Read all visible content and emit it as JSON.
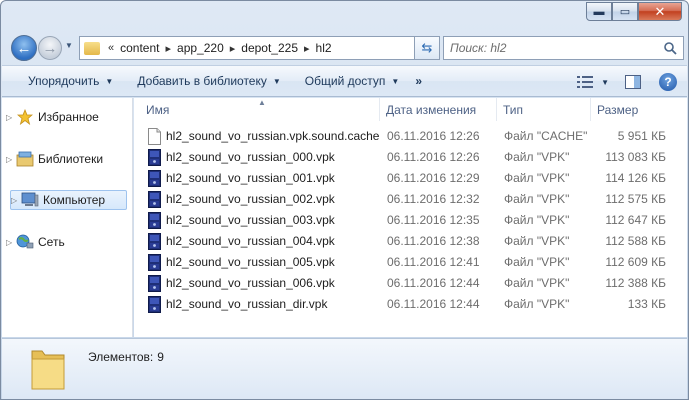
{
  "window": {
    "caption": {
      "minimize": "▬",
      "maximize": "▭",
      "close": "✕"
    }
  },
  "address_bar": {
    "prefix": "«",
    "crumbs": [
      "content",
      "app_220",
      "depot_225",
      "hl2"
    ],
    "separator": "▸"
  },
  "search": {
    "placeholder": "Поиск: hl2"
  },
  "toolbar": {
    "organize": "Упорядочить",
    "add_to_library": "Добавить в библиотеку",
    "share": "Общий доступ",
    "more": "»"
  },
  "nav_pane": {
    "items": [
      {
        "label": "Избранное",
        "icon": "star-icon"
      },
      {
        "label": "Библиотеки",
        "icon": "library-icon"
      },
      {
        "label": "Компьютер",
        "icon": "computer-icon",
        "selected": true
      },
      {
        "label": "Сеть",
        "icon": "network-icon"
      }
    ]
  },
  "file_list": {
    "columns": [
      "Имя",
      "Дата изменения",
      "Тип",
      "Размер"
    ],
    "rows": [
      {
        "name": "hl2_sound_vo_russian.vpk.sound.cache",
        "date": "06.11.2016 12:26",
        "type": "Файл \"CACHE\"",
        "size": "5 951 КБ",
        "icon": "cache-file-icon"
      },
      {
        "name": "hl2_sound_vo_russian_000.vpk",
        "date": "06.11.2016 12:26",
        "type": "Файл \"VPK\"",
        "size": "113 083 КБ",
        "icon": "vpk-file-icon"
      },
      {
        "name": "hl2_sound_vo_russian_001.vpk",
        "date": "06.11.2016 12:29",
        "type": "Файл \"VPK\"",
        "size": "114 126 КБ",
        "icon": "vpk-file-icon"
      },
      {
        "name": "hl2_sound_vo_russian_002.vpk",
        "date": "06.11.2016 12:32",
        "type": "Файл \"VPK\"",
        "size": "112 575 КБ",
        "icon": "vpk-file-icon"
      },
      {
        "name": "hl2_sound_vo_russian_003.vpk",
        "date": "06.11.2016 12:35",
        "type": "Файл \"VPK\"",
        "size": "112 647 КБ",
        "icon": "vpk-file-icon"
      },
      {
        "name": "hl2_sound_vo_russian_004.vpk",
        "date": "06.11.2016 12:38",
        "type": "Файл \"VPK\"",
        "size": "112 588 КБ",
        "icon": "vpk-file-icon"
      },
      {
        "name": "hl2_sound_vo_russian_005.vpk",
        "date": "06.11.2016 12:41",
        "type": "Файл \"VPK\"",
        "size": "112 609 КБ",
        "icon": "vpk-file-icon"
      },
      {
        "name": "hl2_sound_vo_russian_006.vpk",
        "date": "06.11.2016 12:44",
        "type": "Файл \"VPK\"",
        "size": "112 388 КБ",
        "icon": "vpk-file-icon"
      },
      {
        "name": "hl2_sound_vo_russian_dir.vpk",
        "date": "06.11.2016 12:44",
        "type": "Файл \"VPK\"",
        "size": "133 КБ",
        "icon": "vpk-file-icon"
      }
    ]
  },
  "details": {
    "label": "Элементов:",
    "count": "9"
  },
  "colors": {
    "accent": "#2f6fc2",
    "window_frame": "#cfdcec",
    "selection": "#d6e8fb"
  }
}
